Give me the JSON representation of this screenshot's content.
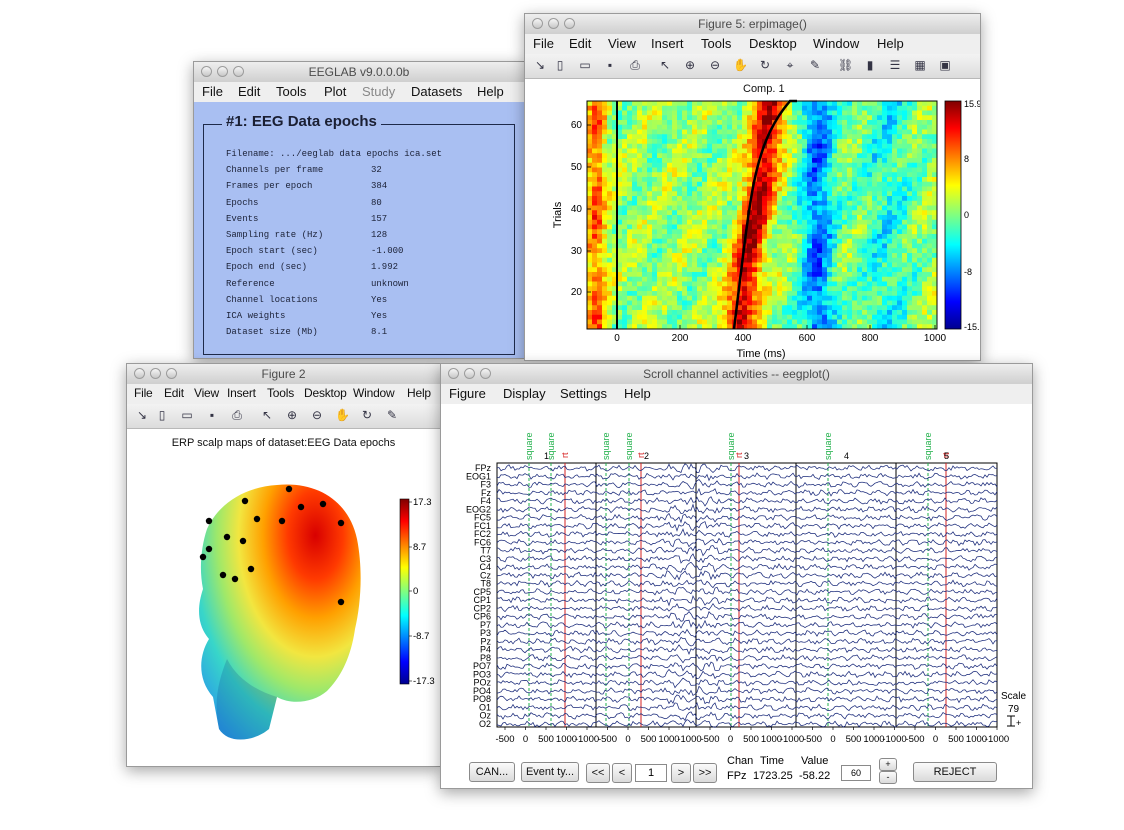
{
  "eeglab": {
    "title": "EEGLAB v9.0.0.0b",
    "menu": [
      "File",
      "Edit",
      "Tools",
      "Plot",
      "Study",
      "Datasets",
      "Help"
    ],
    "panel_title": "#1: EEG Data epochs",
    "rows": [
      {
        "label": "Filename: .../eeglab data epochs ica.set",
        "value": ""
      },
      {
        "label": "Channels per frame",
        "value": "32"
      },
      {
        "label": "Frames per epoch",
        "value": "384"
      },
      {
        "label": "Epochs",
        "value": "80"
      },
      {
        "label": "Events",
        "value": "157"
      },
      {
        "label": "Sampling rate (Hz)",
        "value": "128"
      },
      {
        "label": "Epoch start (sec)",
        "value": "-1.000"
      },
      {
        "label": "Epoch end (sec)",
        "value": "1.992"
      },
      {
        "label": "Reference",
        "value": "unknown"
      },
      {
        "label": "Channel locations",
        "value": "Yes"
      },
      {
        "label": "ICA weights",
        "value": "Yes"
      },
      {
        "label": "Dataset size (Mb)",
        "value": "8.1"
      }
    ],
    "colors": {
      "panel_bg": "#a9bff2"
    }
  },
  "figure5": {
    "title": "Figure 5:  erpimage()",
    "menu": [
      "File",
      "Edit",
      "View",
      "Insert",
      "Tools",
      "Desktop",
      "Window",
      "Help"
    ],
    "toolbar_icons": [
      "arrow-icon",
      "new-file-icon",
      "open-icon",
      "save-icon",
      "print-icon",
      "pointer-icon",
      "zoom-in-icon",
      "zoom-out-icon",
      "pan-icon",
      "rotate-icon",
      "data-cursor-icon",
      "brush-icon",
      "link-icon",
      "colorbar-icon",
      "legend-icon",
      "grid-icon",
      "layout-icon"
    ],
    "plot_title": "Comp. 1",
    "xlabel": "Time (ms)",
    "ylabel": "Trials",
    "xticks": [
      "0",
      "200",
      "400",
      "600",
      "800",
      "1000"
    ],
    "yticks": [
      "20",
      "30",
      "40",
      "50",
      "60"
    ],
    "colorbar_ticks": [
      "15.9",
      "8",
      "0",
      "-8",
      "-15."
    ]
  },
  "figure2": {
    "title": "Figure 2",
    "menu": [
      "File",
      "Edit",
      "View",
      "Insert",
      "Tools",
      "Desktop",
      "Window",
      "Help"
    ],
    "toolbar_icons": [
      "arrow-icon",
      "new-file-icon",
      "open-icon",
      "save-icon",
      "print-icon",
      "pointer-icon",
      "zoom-in-icon",
      "zoom-out-icon",
      "pan-icon",
      "rotate-icon",
      "brush-icon"
    ],
    "plot_title": "ERP scalp maps of dataset:EEG Data epochs",
    "colorbar_ticks": [
      "17.3",
      "8.7",
      "0",
      "-8.7",
      "-17.3"
    ]
  },
  "scroll": {
    "title": "Scroll channel activities -- eegplot()",
    "menu": [
      "Figure",
      "Display",
      "Settings",
      "Help"
    ],
    "event_labels": [
      "square",
      "square",
      "square",
      "square",
      "square",
      "square",
      "square"
    ],
    "rt_labels": [
      "rt",
      "rt",
      "rt",
      "rt"
    ],
    "epoch_numbers": [
      "1",
      "2",
      "3",
      "4",
      "5"
    ],
    "channels": [
      "FPz",
      "EOG1",
      "F3",
      "Fz",
      "F4",
      "EOG2",
      "FC5",
      "FC1",
      "FC2",
      "FC6",
      "T7",
      "C3",
      "C4",
      "Cz",
      "T8",
      "CP5",
      "CP1",
      "CP2",
      "CP6",
      "P7",
      "P3",
      "Pz",
      "P4",
      "P8",
      "PO7",
      "PO3",
      "POz",
      "PO4",
      "PO8",
      "O1",
      "Oz",
      "O2"
    ],
    "xticks": [
      "-500",
      "0",
      "500",
      "1000",
      "-1000",
      "-500",
      "0",
      "500",
      "1000",
      "-1000",
      "-500",
      "0",
      "500",
      "1000",
      "-1000",
      "-500",
      "0",
      "500",
      "1000",
      "-1000",
      "-500",
      "0",
      "500",
      "1000",
      "-1000"
    ],
    "scale_label": "Scale",
    "scale_value": "79",
    "buttons": {
      "cancel": "CAN...",
      "events": "Event ty...",
      "first": "<<",
      "prev": "<",
      "next": ">",
      "last": ">>",
      "reject": "REJECT",
      "plus": "+",
      "minus": "-"
    },
    "page_value": "1",
    "readout": {
      "chan_label": "Chan",
      "time_label": "Time",
      "value_label": "Value",
      "chan": "FPz",
      "time": "1723.25",
      "value": "-58.22"
    },
    "scale_field": "60"
  }
}
